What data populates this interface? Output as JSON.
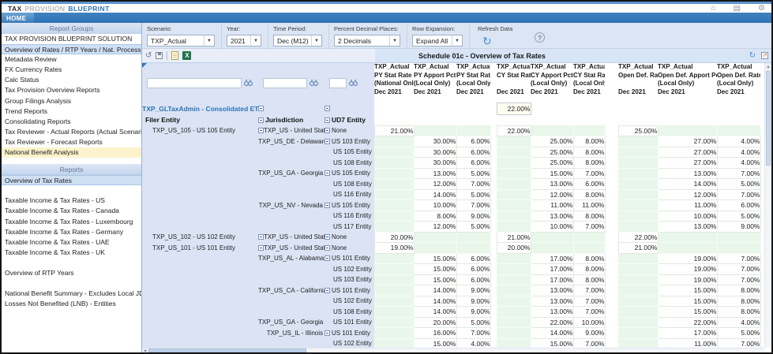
{
  "window": {
    "title": {
      "tax": "TAX",
      "provision": "PROVISION",
      "blueprint": "BLUEPRINT"
    },
    "accent_color": "#2e74b5"
  },
  "nav": {
    "home_tab": "HOME"
  },
  "sidebar": {
    "groups_header": "Report Groups",
    "group_items": [
      {
        "label": "TAX PROVISION BLUEPRINT SOLUTION",
        "state": "normal"
      },
      {
        "label": "Overview of Rates / RTP Years / Nat. Process / LNB",
        "state": "selected"
      },
      {
        "label": "Metadata Review",
        "state": "normal"
      },
      {
        "label": "FX Currency Rates",
        "state": "normal"
      },
      {
        "label": "Calc Status",
        "state": "normal"
      },
      {
        "label": "Tax Provision Overview Reports",
        "state": "normal"
      },
      {
        "label": "Group Filings Analysis",
        "state": "normal"
      },
      {
        "label": "Trend Reports",
        "state": "normal"
      },
      {
        "label": "Consolidating Reports",
        "state": "normal"
      },
      {
        "label": "Tax Reviewer - Actual Reports  (Actual Scenario only)",
        "state": "normal"
      },
      {
        "label": "Tax Reviewer - Forecast Reports",
        "state": "normal"
      },
      {
        "label": "National Benefit Analysis",
        "state": "highlighted"
      }
    ],
    "reports_header": "Reports",
    "report_items": [
      {
        "label": "Overview of Tax Rates",
        "state": "selected"
      },
      {
        "label": "",
        "state": "spacer"
      },
      {
        "label": "Taxable Income & Tax Rates - US",
        "state": "normal"
      },
      {
        "label": "Taxable Income & Tax Rates - Canada",
        "state": "normal"
      },
      {
        "label": "Taxable Income & Tax Rates - Luxembourg",
        "state": "normal"
      },
      {
        "label": "Taxable Income & Tax Rates - Germany",
        "state": "normal"
      },
      {
        "label": "Taxable Income & Tax Rates - UAE",
        "state": "normal"
      },
      {
        "label": "Taxable Income & Tax Rates - UK",
        "state": "normal"
      },
      {
        "label": "",
        "state": "spacer"
      },
      {
        "label": "Overview of RTP Years",
        "state": "normal"
      },
      {
        "label": "",
        "state": "spacer"
      },
      {
        "label": "National Benefit Summary - Excludes Local JD",
        "state": "normal"
      },
      {
        "label": "Losses Not Benefited (LNB) - Entities",
        "state": "normal"
      }
    ]
  },
  "toolbar": {
    "controls": [
      {
        "label": "Scenario:",
        "value": "TXP_Actual"
      },
      {
        "label": "Year:",
        "value": "2021"
      },
      {
        "label": "Time Period:",
        "value": "Dec  (M12)"
      },
      {
        "label": "Percent Decimal Places:",
        "value": "2 Decimals"
      },
      {
        "label": "Row Expansion:",
        "value": "Expand All"
      }
    ],
    "refresh_label": "Refresh Data",
    "help_label": "?"
  },
  "schedule": {
    "title": "Schedule 01c - Overview of Tax Rates"
  },
  "grid": {
    "corner_caption": "TXP_GLTaxAdmin - Consolidated ETR Rate",
    "row_captions": {
      "filer": "Filer Entity",
      "jurisdiction": "Jurisdiction",
      "ud7": "UD7 Entity"
    },
    "filters": [
      {
        "value": "",
        "placeholder": ""
      },
      {
        "value": "",
        "placeholder": ""
      },
      {
        "value": "",
        "placeholder": ""
      }
    ],
    "col_headers": [
      [
        "TXP_Actual",
        "PY Stat Rate",
        "(National Only)",
        "Dec 2021"
      ],
      [
        "TXP_Actual",
        "PY Apport Pct",
        "(Local Only)",
        "Dec 2021"
      ],
      [
        "TXP_Actual",
        "PY Stat Rate",
        "(Local Only)",
        "Dec 2021"
      ],
      [
        "TXP_Actual",
        "CY Stat Rate",
        "",
        "Dec 2021"
      ],
      [
        "TXP_Actual",
        "CY Apport Pct",
        "(Local Only)",
        "Dec 2021"
      ],
      [
        "TXP_Actual",
        "CY Stat Rate",
        "(Local Only)",
        "Dec 2021"
      ],
      [
        "TXP_Actual",
        "Open Def. Rate",
        "",
        "Dec 2021"
      ],
      [
        "TXP_Actual",
        "Open Def. Apport Pct",
        "(Local Only)",
        "Dec 2021"
      ],
      [
        "TXP_Actual",
        "Open Def. Rate",
        "(Local Only)",
        "Dec 2021"
      ]
    ],
    "consolidated_value": "22.00%",
    "rows": [
      {
        "filer": "TXP_US_105 - US 105 Entity",
        "jur": "TXP_US - United States",
        "jbox": true,
        "ud7": "None",
        "ubox": true,
        "v": [
          "21.00%",
          "",
          "",
          "22.00%",
          "",
          "",
          "25.00%",
          "",
          ""
        ]
      },
      {
        "jur": "TXP_US_DE - Delaware",
        "ud7": "US 103 Entity",
        "ubox": true,
        "v": [
          "",
          "30.00%",
          "6.00%",
          "",
          "25.00%",
          "8.00%",
          "",
          "27.00%",
          "4.00%"
        ]
      },
      {
        "ud7": "US 105 Entity",
        "v": [
          "",
          "30.00%",
          "6.00%",
          "",
          "25.00%",
          "8.00%",
          "",
          "27.00%",
          "4.00%"
        ]
      },
      {
        "ud7": "US 108 Entity",
        "v": [
          "",
          "30.00%",
          "6.00%",
          "",
          "25.00%",
          "8.00%",
          "",
          "27.00%",
          "4.00%"
        ]
      },
      {
        "jur": "TXP_US_GA - Georgia",
        "ud7": "US 105 Entity",
        "ubox": true,
        "v": [
          "",
          "13.00%",
          "5.00%",
          "",
          "15.00%",
          "7.00%",
          "",
          "13.00%",
          "7.00%"
        ]
      },
      {
        "ud7": "US 108 Entity",
        "v": [
          "",
          "12.00%",
          "7.00%",
          "",
          "13.00%",
          "6.00%",
          "",
          "14.00%",
          "5.00%"
        ]
      },
      {
        "ud7": "US 116 Entity",
        "v": [
          "",
          "14.00%",
          "5.00%",
          "",
          "12.00%",
          "8.00%",
          "",
          "12.00%",
          "7.00%"
        ]
      },
      {
        "jur": "TXP_US_NV - Nevada",
        "ud7": "US 105 Entity",
        "ubox": true,
        "v": [
          "",
          "10.00%",
          "7.00%",
          "",
          "11.00%",
          "11.00%",
          "",
          "11.00%",
          "6.00%"
        ]
      },
      {
        "ud7": "US 116 Entity",
        "v": [
          "",
          "8.00%",
          "9.00%",
          "",
          "13.00%",
          "8.00%",
          "",
          "10.00%",
          "5.00%"
        ]
      },
      {
        "ud7": "US 117 Entity",
        "v": [
          "",
          "12.00%",
          "5.00%",
          "",
          "10.00%",
          "7.00%",
          "",
          "13.00%",
          "9.00%"
        ]
      },
      {
        "filer": "TXP_US_102 - US 102 Entity",
        "jur": "TXP_US - United States",
        "jbox": true,
        "ud7": "None",
        "ubox": true,
        "v": [
          "20.00%",
          "",
          "",
          "21.00%",
          "",
          "",
          "22.00%",
          "",
          ""
        ]
      },
      {
        "filer": "TXP_US_101 - US 101 Entity",
        "jur": "TXP_US - United States",
        "jbox": true,
        "ud7": "None",
        "ubox": true,
        "v": [
          "19.00%",
          "",
          "",
          "20.00%",
          "",
          "",
          "21.00%",
          "",
          ""
        ]
      },
      {
        "jur": "TXP_US_AL - Alabama",
        "ud7": "US 101 Entity",
        "ubox": true,
        "v": [
          "",
          "15.00%",
          "6.00%",
          "",
          "17.00%",
          "8.00%",
          "",
          "19.00%",
          "7.00%"
        ]
      },
      {
        "ud7": "US 102 Entity",
        "v": [
          "",
          "15.00%",
          "6.00%",
          "",
          "17.00%",
          "8.00%",
          "",
          "19.00%",
          "7.00%"
        ]
      },
      {
        "ud7": "US 103 Entity",
        "v": [
          "",
          "15.00%",
          "6.00%",
          "",
          "17.00%",
          "8.00%",
          "",
          "19.00%",
          "7.00%"
        ]
      },
      {
        "jur": "TXP_US_CA - California",
        "ud7": "US 101 Entity",
        "ubox": true,
        "v": [
          "",
          "14.00%",
          "9.00%",
          "",
          "13.00%",
          "7.00%",
          "",
          "15.00%",
          "8.00%"
        ]
      },
      {
        "ud7": "US 102 Entity",
        "v": [
          "",
          "14.00%",
          "9.00%",
          "",
          "13.00%",
          "7.00%",
          "",
          "15.00%",
          "8.00%"
        ]
      },
      {
        "ud7": "US 108 Entity",
        "v": [
          "",
          "14.00%",
          "9.00%",
          "",
          "13.00%",
          "7.00%",
          "",
          "15.00%",
          "8.00%"
        ]
      },
      {
        "jur": "TXP_US_GA - Georgia",
        "ud7": "US 101 Entity",
        "ubox": false,
        "v": [
          "",
          "20.00%",
          "5.00%",
          "",
          "22.00%",
          "10.00%",
          "",
          "22.00%",
          "4.00%"
        ]
      },
      {
        "jur": "TXP_US_IL - Illinois",
        "ud7": "US 101 Entity",
        "ubox": true,
        "v": [
          "",
          "16.00%",
          "7.00%",
          "",
          "14.00%",
          "9.00%",
          "",
          "17.00%",
          "5.00%"
        ]
      },
      {
        "ud7": "US 102 Entity",
        "v": [
          "",
          "15.00%",
          "4.00%",
          "",
          "15.00%",
          "7.00%",
          "",
          "11.00%",
          "7.00%"
        ]
      }
    ]
  }
}
